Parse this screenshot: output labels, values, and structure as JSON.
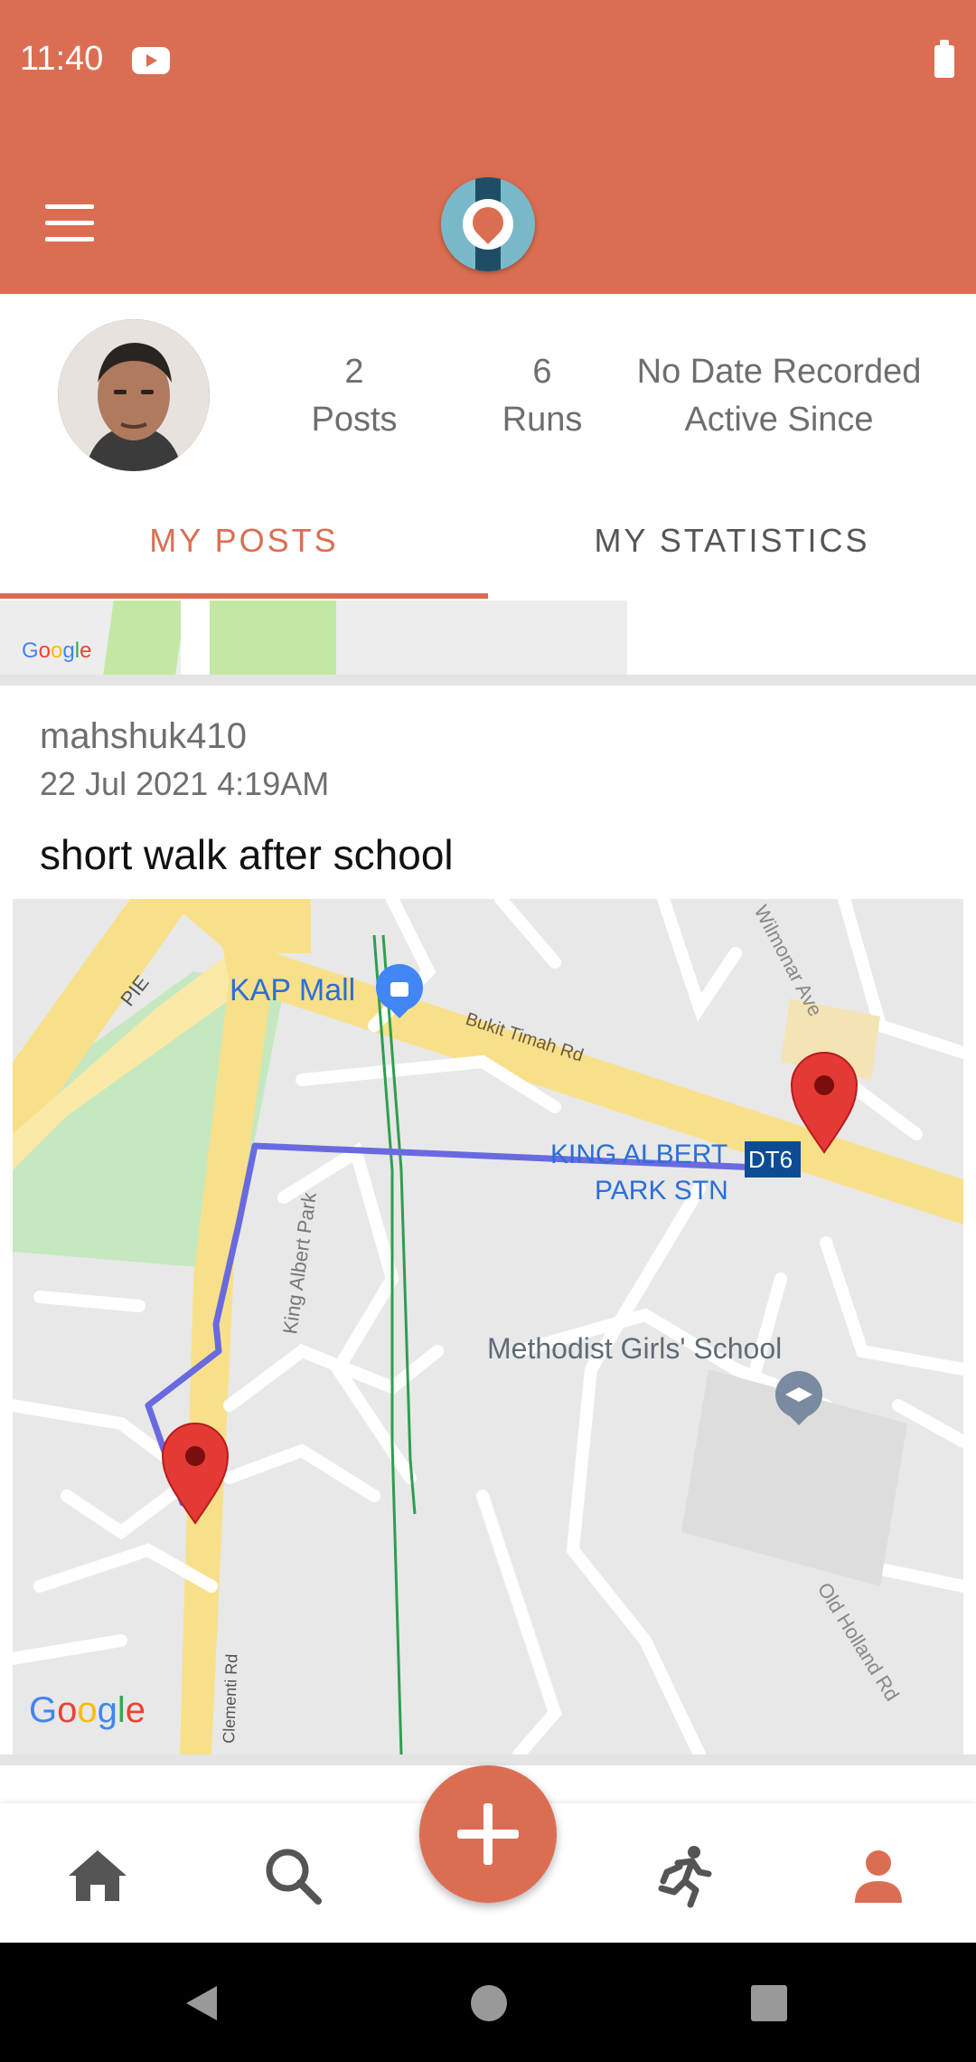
{
  "status_bar": {
    "time": "11:40",
    "notification_icon": "youtube-icon",
    "battery_icon": "battery-icon"
  },
  "app_bar": {
    "menu_icon": "menu-icon",
    "logo_icon": "app-logo-icon"
  },
  "profile": {
    "avatar_icon": "avatar",
    "posts_count": "2",
    "posts_label": "Posts",
    "runs_count": "6",
    "runs_label": "Runs",
    "active_since_value": "No Date Recorded",
    "active_since_label": "Active Since"
  },
  "tabs": [
    {
      "label": "MY POSTS",
      "active": true
    },
    {
      "label": "MY STATISTICS",
      "active": false
    }
  ],
  "map_attribution": "Google",
  "post": {
    "username": "mahshuk410",
    "date": "22 Jul 2021 4:19AM",
    "title": "short walk after school",
    "map_labels": {
      "kap_mall": "KAP Mall",
      "pie": "PIE",
      "bukit_timah": "Bukit Timah Rd",
      "wilmonar": "Wilmonar Ave",
      "king_albert_stn_line1": "KING ALBERT",
      "king_albert_stn_line2": "PARK STN",
      "station_code": "DT6",
      "king_albert_park": "King Albert Park",
      "methodist": "Methodist Girls' School",
      "clementi": "Clementi Rd",
      "old_holland": "Old Holland Rd"
    }
  },
  "bottom_nav": {
    "items": [
      "home-icon",
      "search-icon",
      "add-button",
      "run-icon",
      "profile-icon"
    ]
  },
  "colors": {
    "accent": "#DB6E52",
    "route": "#6A6AE0",
    "marker": "#E53935"
  }
}
